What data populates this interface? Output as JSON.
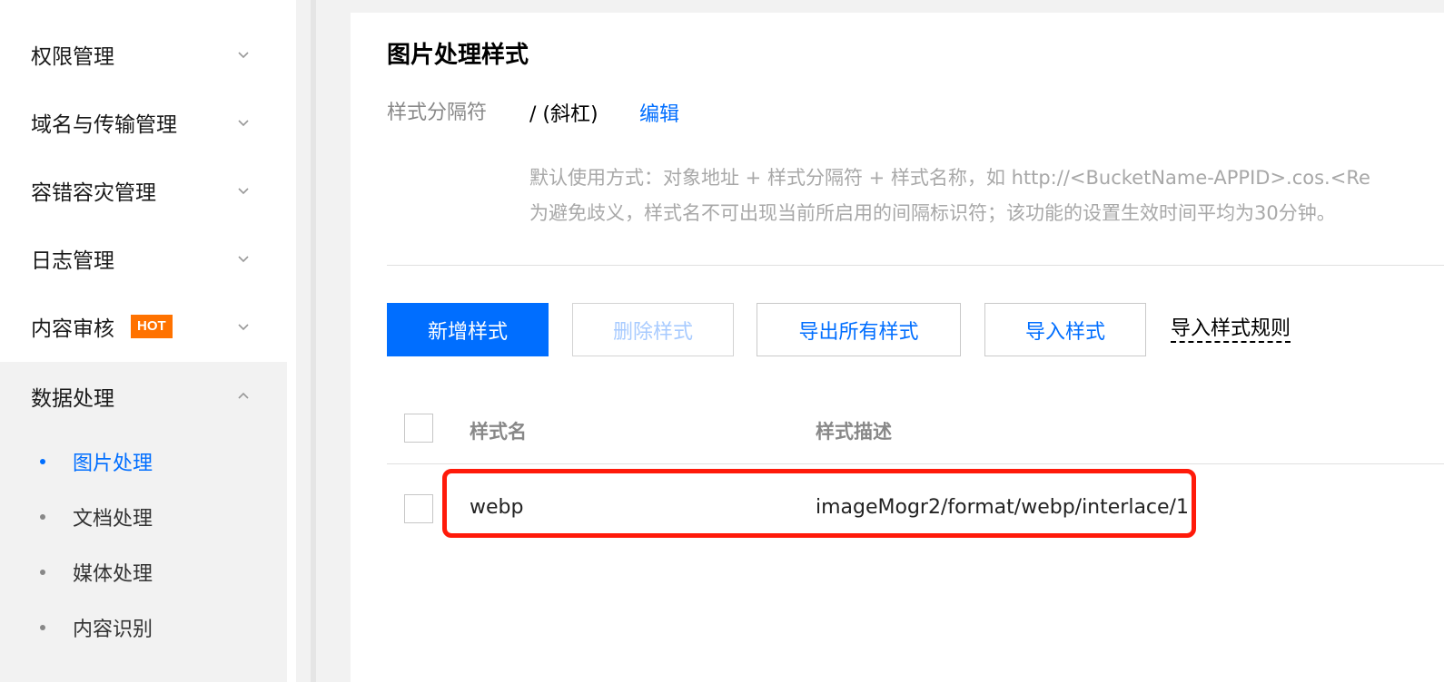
{
  "sidebar": {
    "items": [
      {
        "label": "权限管理"
      },
      {
        "label": "域名与传输管理"
      },
      {
        "label": "容错容灾管理"
      },
      {
        "label": "日志管理"
      },
      {
        "label": "内容审核",
        "badge": "HOT"
      },
      {
        "label": "数据处理"
      }
    ],
    "sub_items": [
      {
        "label": "图片处理",
        "active": true
      },
      {
        "label": "文档处理"
      },
      {
        "label": "媒体处理"
      },
      {
        "label": "内容识别"
      }
    ]
  },
  "main": {
    "title": "图片处理样式",
    "separator_label": "样式分隔符",
    "separator_value": "/ (斜杠)",
    "edit_label": "编辑",
    "hint_line1": "默认使用方式：对象地址 + 样式分隔符 + 样式名称，如 http://<BucketName-APPID>.cos.<Re",
    "hint_line2": "为避免歧义，样式名不可出现当前所启用的间隔标识符；该功能的设置生效时间平均为30分钟。",
    "buttons": {
      "add": "新增样式",
      "delete": "删除样式",
      "export_all": "导出所有样式",
      "import": "导入样式",
      "import_rules": "导入样式规则"
    },
    "table": {
      "columns": [
        "样式名",
        "样式描述"
      ],
      "rows": [
        {
          "name": "webp",
          "description": "imageMogr2/format/webp/interlace/1"
        }
      ]
    }
  },
  "colors": {
    "accent": "#006eff",
    "badge": "#ff7200",
    "highlight": "#ff1a0a"
  }
}
